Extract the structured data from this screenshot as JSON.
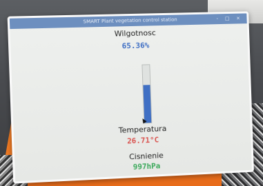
{
  "window": {
    "title": "SMART Plant vegetation control station",
    "controls": "- □ ×"
  },
  "humidity": {
    "label": "Wilgotnosc",
    "value": "65.36%",
    "level_fraction": 0.6536,
    "color": "#3f6fc4"
  },
  "temperature": {
    "label": "Temperatura",
    "value": "26.71°C",
    "color": "#d9534f"
  },
  "pressure": {
    "label": "Cisnienie",
    "value": "997hPa",
    "color": "#3aa85a"
  }
}
